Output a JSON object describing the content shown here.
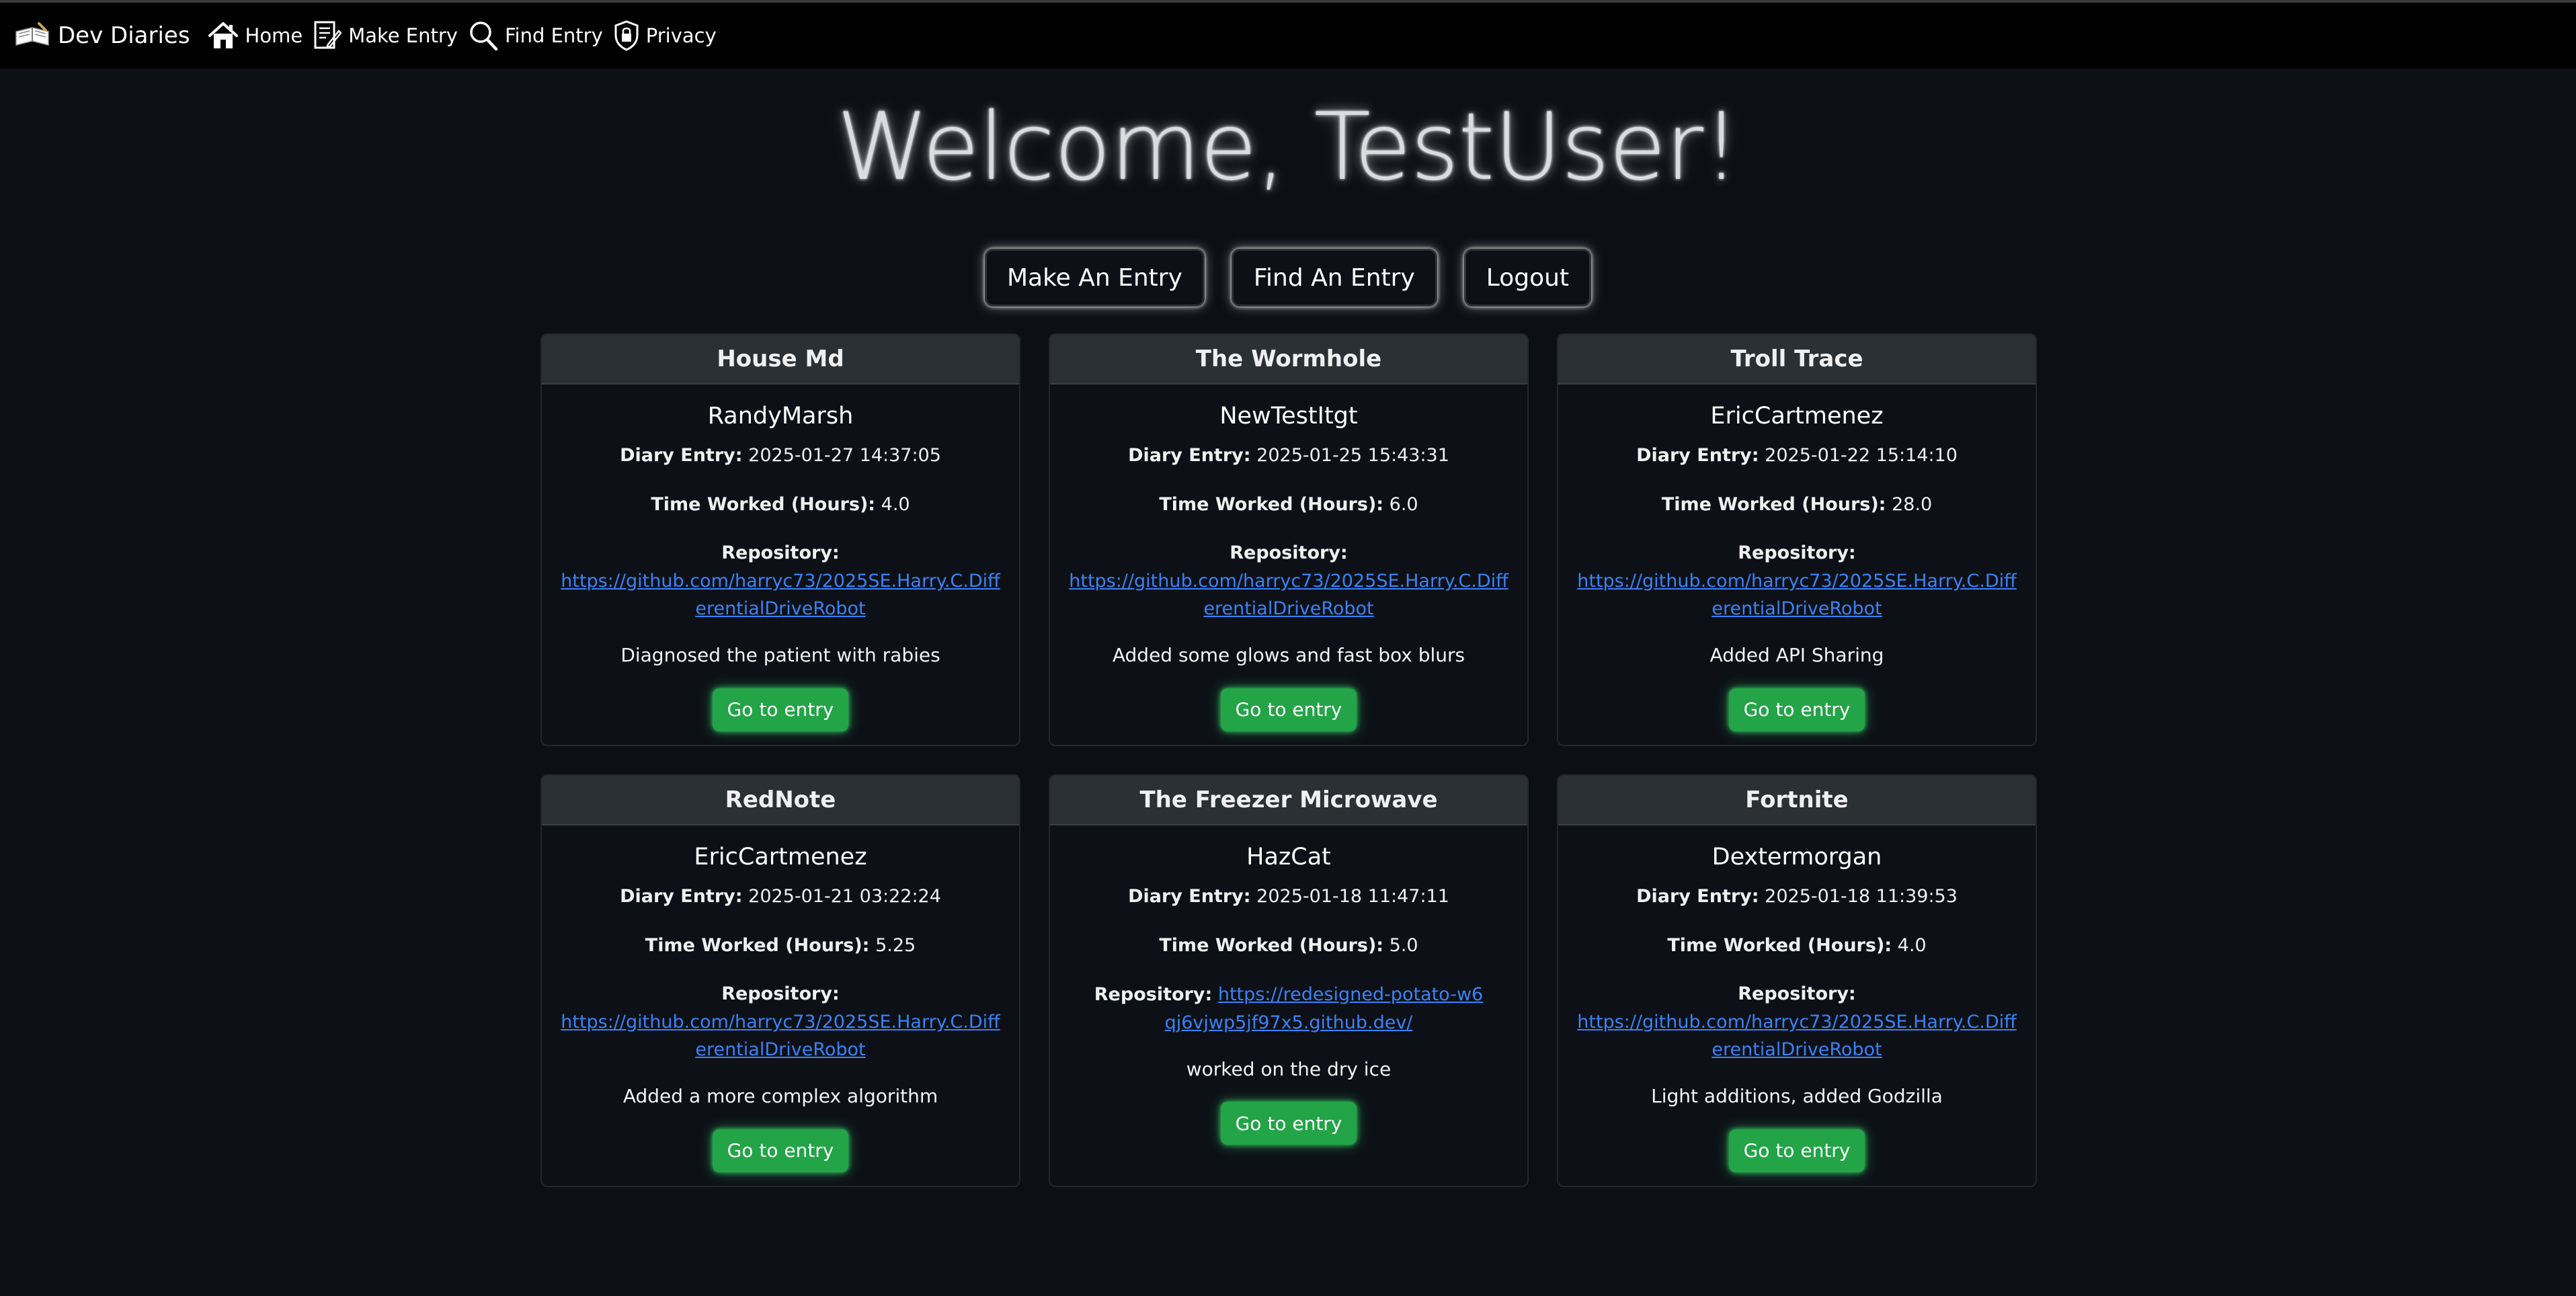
{
  "nav": {
    "brand": "Dev Diaries",
    "brand_icon": "book-icon",
    "items": [
      {
        "label": "Home",
        "icon": "home-icon"
      },
      {
        "label": "Make Entry",
        "icon": "pencil-note-icon"
      },
      {
        "label": "Find Entry",
        "icon": "search-icon"
      },
      {
        "label": "Privacy",
        "icon": "shield-lock-icon"
      }
    ]
  },
  "welcome": "Welcome, TestUser!",
  "actions": {
    "make": "Make An Entry",
    "find": "Find An Entry",
    "logout": "Logout"
  },
  "labels": {
    "diary_entry": "Diary Entry:",
    "time_worked": "Time Worked (Hours):",
    "repository": "Repository:",
    "go_button": "Go to entry"
  },
  "entries": [
    {
      "title": "House Md",
      "author": "RandyMarsh",
      "date": "2025-01-27 14:37:05",
      "hours": "4.0",
      "repo": "https://github.com/harryc73/2025SE.Harry.C.DifferentialDriveRobot",
      "description": "Diagnosed the patient with rabies"
    },
    {
      "title": "The Wormhole",
      "author": "NewTestItgt",
      "date": "2025-01-25 15:43:31",
      "hours": "6.0",
      "repo": "https://github.com/harryc73/2025SE.Harry.C.DifferentialDriveRobot",
      "description": "Added some glows and fast box blurs"
    },
    {
      "title": "Troll Trace",
      "author": "EricCartmenez",
      "date": "2025-01-22 15:14:10",
      "hours": "28.0",
      "repo": "https://github.com/harryc73/2025SE.Harry.C.DifferentialDriveRobot",
      "description": "Added API Sharing"
    },
    {
      "title": "RedNote",
      "author": "EricCartmenez",
      "date": "2025-01-21 03:22:24",
      "hours": "5.25",
      "repo": "https://github.com/harryc73/2025SE.Harry.C.DifferentialDriveRobot",
      "description": "Added a more complex algorithm"
    },
    {
      "title": "The Freezer Microwave",
      "author": "HazCat",
      "date": "2025-01-18 11:47:11",
      "hours": "5.0",
      "repo": "https://redesigned-potato-w6qj6vjwp5jf97x5.github.dev/",
      "description": "worked on the dry ice"
    },
    {
      "title": "Fortnite",
      "author": "Dextermorgan",
      "date": "2025-01-18 11:39:53",
      "hours": "4.0",
      "repo": "https://github.com/harryc73/2025SE.Harry.C.DifferentialDriveRobot",
      "description": "Light additions, added Godzilla"
    }
  ]
}
